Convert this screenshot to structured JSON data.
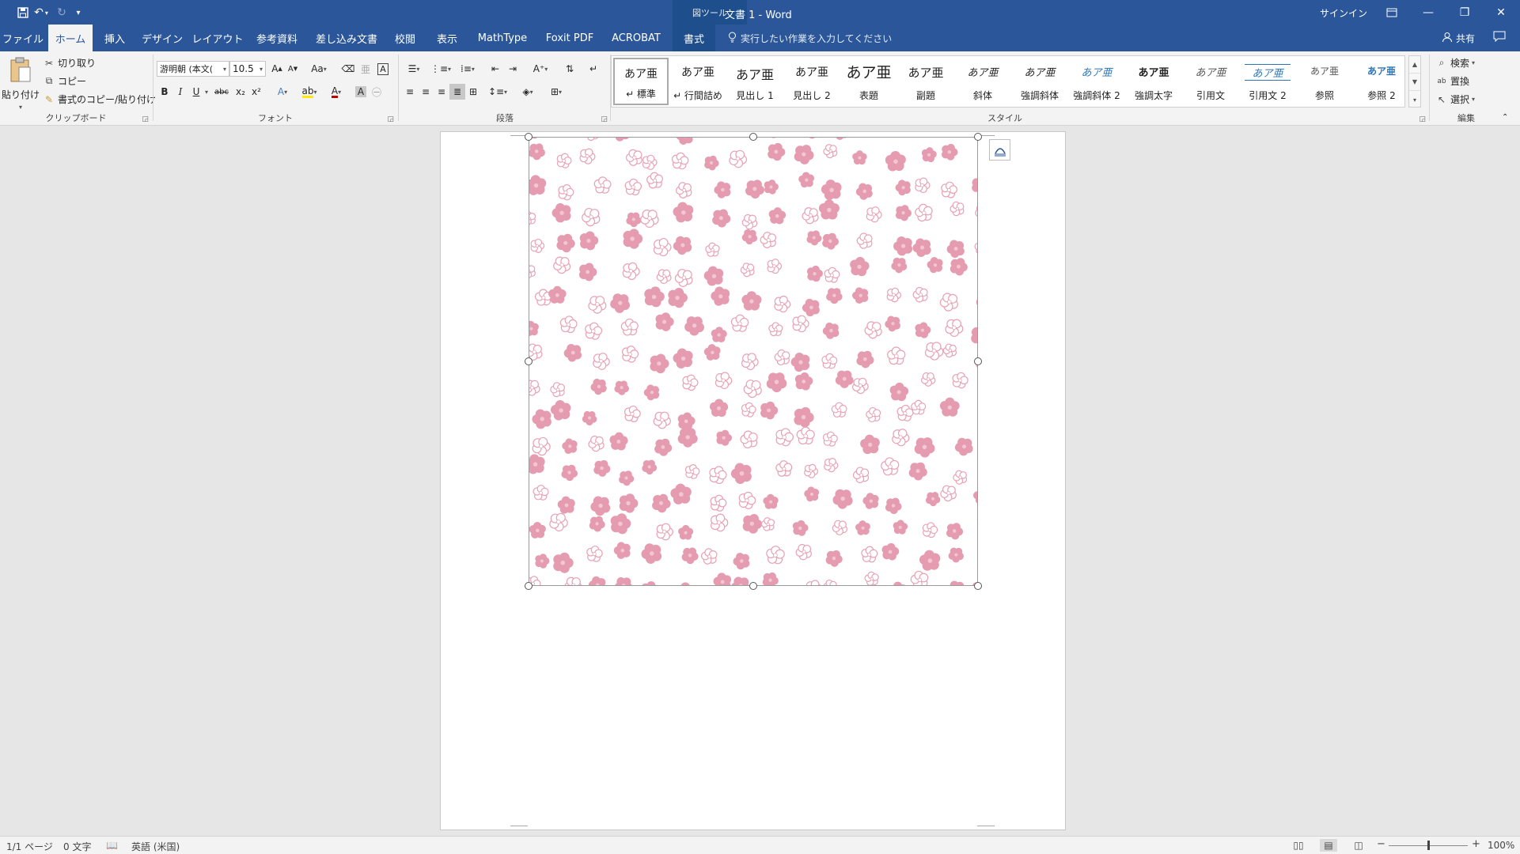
{
  "window": {
    "title": "文書 1  -  Word",
    "context_label": "図ツール",
    "signin": "サインイン",
    "qat": {
      "save_icon": "save-icon",
      "undo_icon": "undo-icon",
      "redo_icon": "redo-icon",
      "customize_icon": "customize-qat-icon"
    }
  },
  "tabs": [
    {
      "label": "ファイル"
    },
    {
      "label": "ホーム"
    },
    {
      "label": "挿入"
    },
    {
      "label": "デザイン"
    },
    {
      "label": "レイアウト"
    },
    {
      "label": "参考資料"
    },
    {
      "label": "差し込み文書"
    },
    {
      "label": "校閲"
    },
    {
      "label": "表示"
    },
    {
      "label": "MathType"
    },
    {
      "label": "Foxit PDF"
    },
    {
      "label": "ACROBAT"
    },
    {
      "label": "書式"
    }
  ],
  "tell_me": {
    "placeholder": "実行したい作業を入力してください"
  },
  "share": {
    "label": "共有"
  },
  "clipboard": {
    "paste": "貼り付け",
    "cut": "切り取り",
    "copy": "コピー",
    "format_painter": "書式のコピー/貼り付け",
    "label": "クリップボード"
  },
  "font": {
    "name": "游明朝 (本文(",
    "size": "10.5",
    "label": "フォント",
    "change_case": "Aa",
    "grow": "A",
    "shrink": "A",
    "bold": "B",
    "italic": "I",
    "underline": "U",
    "strike": "abc",
    "subscript": "x₂",
    "superscript": "x²",
    "accent_color": "#c00000"
  },
  "paragraph": {
    "label": "段落"
  },
  "styles": {
    "label": "スタイル",
    "items": [
      {
        "preview": "あア亜",
        "name": "↵ 標準"
      },
      {
        "preview": "あア亜",
        "name": "↵ 行間詰め"
      },
      {
        "preview": "あア亜",
        "name": "見出し 1"
      },
      {
        "preview": "あア亜",
        "name": "見出し 2"
      },
      {
        "preview": "あア亜",
        "name": "表題"
      },
      {
        "preview": "あア亜",
        "name": "副題"
      },
      {
        "preview": "あア亜",
        "name": "斜体"
      },
      {
        "preview": "あア亜",
        "name": "強調斜体"
      },
      {
        "preview": "あア亜",
        "name": "強調斜体 2"
      },
      {
        "preview": "あア亜",
        "name": "強調太字"
      },
      {
        "preview": "あア亜",
        "name": "引用文"
      },
      {
        "preview": "あア亜",
        "name": "引用文 2"
      },
      {
        "preview": "あア亜",
        "name": "参照"
      },
      {
        "preview": "あア亜",
        "name": "参照 2"
      }
    ]
  },
  "editing": {
    "label": "編集",
    "find": "検索",
    "replace": "置換",
    "select": "選択"
  },
  "status": {
    "page": "1/1 ページ",
    "words": "0 文字",
    "language": "英語 (米国)",
    "zoom": "100%",
    "zoom_minus": "−",
    "zoom_plus": "+",
    "zoom_level": 1.0
  },
  "colors": {
    "brand": "#2b579a",
    "blossom_fill": "#e59bb0",
    "blossom_outline": "#e8a1b5"
  }
}
